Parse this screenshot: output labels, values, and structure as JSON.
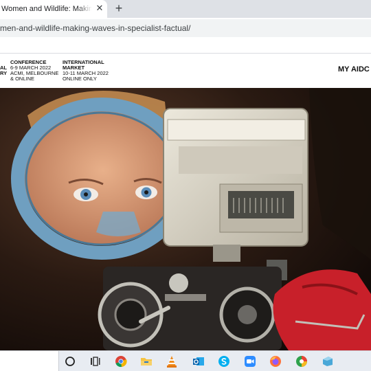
{
  "browser": {
    "tab_title": "Women and Wildlife: Making Wa",
    "close_glyph": "✕",
    "new_tab_glyph": "+",
    "url": "men-and-wildlife-making-waves-in-specialist-factual/"
  },
  "header": {
    "fragment_lines": [
      "AL",
      "RY"
    ],
    "conference": {
      "heading": "CONFERENCE",
      "line1": "6-9 MARCH 2022",
      "line2": "ACMI, MELBOURNE",
      "line3": "& ONLINE"
    },
    "market": {
      "heading_line1": "INTERNATIONAL",
      "heading_line2": "MARKET",
      "line1": "10-11 MARCH 2022",
      "line2": "ONLINE ONLY"
    },
    "account_label": "MY AIDC"
  },
  "taskbar": {
    "icons": [
      "cortana-icon",
      "task-view-icon",
      "chrome-icon",
      "file-explorer-icon",
      "vlc-icon",
      "outlook-icon",
      "skype-icon",
      "zoom-icon",
      "firefox-icon",
      "browser-icon",
      "app-icon"
    ]
  },
  "colors": {
    "tab_strip": "#dee1e6",
    "omnibox": "#f1f3f4",
    "mask_frame": "#6f9fc0",
    "camera_housing": "#d8d4c8",
    "red_fabric": "#c8202a"
  }
}
